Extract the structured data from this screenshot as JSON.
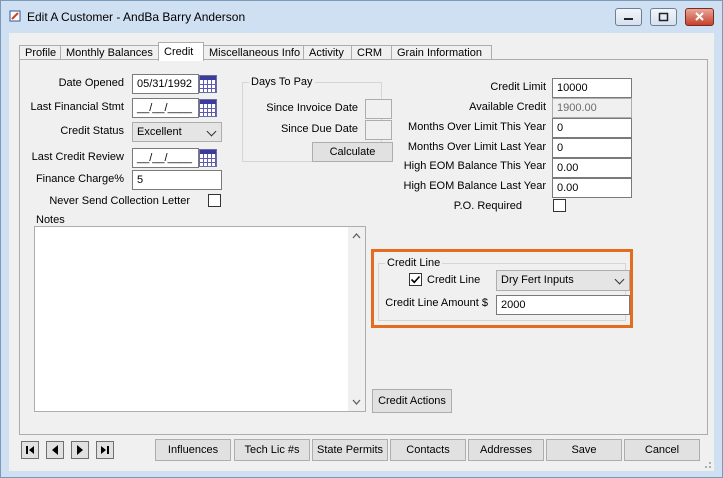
{
  "window": {
    "title": "Edit A Customer - AndBa Barry Anderson",
    "icon": "app-edit-icon",
    "controls": [
      "minimize-icon",
      "maximize-icon",
      "close-icon"
    ]
  },
  "tabs": [
    {
      "label": "Profile",
      "active": false
    },
    {
      "label": "Monthly Balances",
      "active": false
    },
    {
      "label": "Credit",
      "active": true
    },
    {
      "label": "Miscellaneous Info",
      "active": false
    },
    {
      "label": "Activity",
      "active": false
    },
    {
      "label": "CRM",
      "active": false
    },
    {
      "label": "Grain Information",
      "active": false
    }
  ],
  "left": {
    "date_opened_label": "Date Opened",
    "date_opened_value": "05/31/1992",
    "last_fin_label": "Last Financial Stmt",
    "last_fin_value": "__/__/____",
    "credit_status_label": "Credit Status",
    "credit_status_value": "Excellent",
    "last_review_label": "Last Credit Review",
    "last_review_value": "__/__/____",
    "finance_charge_label": "Finance Charge%",
    "finance_charge_value": "5",
    "never_send_label": "Never Send Collection Letter",
    "never_send_checked": false,
    "notes_label": "Notes"
  },
  "days_to_pay": {
    "title": "Days To Pay",
    "since_invoice_label": "Since Invoice Date",
    "since_invoice_value": "",
    "since_due_label": "Since Due Date",
    "since_due_value": "",
    "calculate_label": "Calculate"
  },
  "right": {
    "credit_limit_label": "Credit Limit",
    "credit_limit_value": "10000",
    "available_label": "Available Credit",
    "available_value": "1900.00",
    "months_over_this_label": "Months Over Limit This Year",
    "months_over_this_value": "0",
    "months_over_last_label": "Months Over Limit Last Year",
    "months_over_last_value": "0",
    "eom_this_label": "High EOM Balance This Year",
    "eom_this_value": "0.00",
    "eom_last_label": "High EOM Balance Last Year",
    "eom_last_value": "0.00",
    "po_required_label": "P.O. Required",
    "po_required_checked": false
  },
  "credit_line": {
    "group_label": "Credit Line",
    "checkbox_label": "Credit Line",
    "checked": true,
    "select_value": "Dry Fert Inputs",
    "amount_label": "Credit Line Amount $",
    "amount_value": "2000",
    "highlight_color": "#e36c1e"
  },
  "credit_actions_label": "Credit Actions",
  "footer": {
    "nav_icons": [
      "first-record-icon",
      "previous-record-icon",
      "next-record-icon",
      "last-record-icon"
    ],
    "buttons": [
      "Influences",
      "Tech Lic #s",
      "State Permits",
      "Contacts",
      "Addresses",
      "Save",
      "Cancel"
    ]
  }
}
